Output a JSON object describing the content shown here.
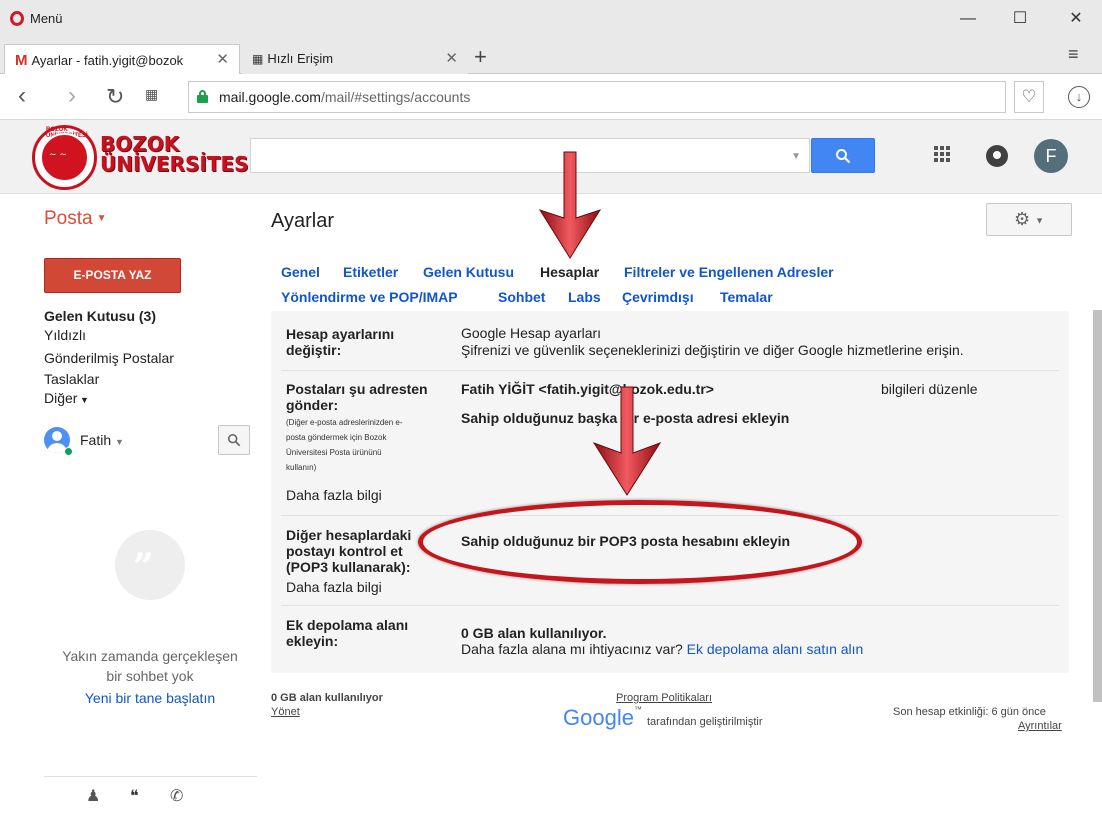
{
  "browser": {
    "menu_label": "Menü",
    "tabs": [
      {
        "label": "Ayarlar - fatih.yigit@bozok",
        "active": true
      },
      {
        "label": "Hızlı Erişim",
        "active": false
      }
    ],
    "url_host": "mail.google.com",
    "url_path": "/mail/#settings/accounts"
  },
  "brand": {
    "line1": "BOZOK",
    "line2": "ÜNİVERSİTESİ",
    "seal_ring": "BOZOK ÜNİVERSİTESİ",
    "seal_year": "2006",
    "user_initial": "F"
  },
  "header": {
    "posta_label": "Posta",
    "page_title": "Ayarlar"
  },
  "sidebar": {
    "compose_label": "E-POSTA YAZ",
    "items": [
      {
        "label": "Gelen Kutusu (3)",
        "bold": true
      },
      {
        "label": "Yıldızlı",
        "bold": false
      },
      {
        "label": "Gönderilmiş Postalar",
        "bold": false
      },
      {
        "label": "Taslaklar",
        "bold": false
      },
      {
        "label": "Diğer",
        "bold": false
      }
    ],
    "user_name": "Fatih",
    "chat_empty_line1": "Yakın zamanda gerçekleşen",
    "chat_empty_line2": "bir sohbet yok",
    "chat_start": "Yeni bir tane başlatın"
  },
  "settings_tabs": {
    "row1": [
      "Genel",
      "Etiketler",
      "Gelen Kutusu",
      "Hesaplar",
      "Filtreler ve Engellenen Adresler"
    ],
    "row2": [
      "Yönlendirme ve POP/IMAP",
      "Sohbet",
      "Labs",
      "Çevrimdışı",
      "Temalar"
    ],
    "current": "Hesaplar"
  },
  "sections": {
    "account": {
      "label_line1": "Hesap ayarlarını",
      "label_line2": "değiştir:",
      "link": "Google Hesap ayarları",
      "desc": "Şifrenizi ve güvenlik seçeneklerinizi değiştirin ve diğer Google hizmetlerine erişin."
    },
    "send_as": {
      "label_line1": "Postaları şu adresten",
      "label_line2": "gönder:",
      "note_lines": [
        "(Diğer e-posta adreslerinizden e-",
        "posta göndermek için Bozok",
        "Üniversitesi Posta ürününü",
        "kullanın)"
      ],
      "more_info": "Daha fazla bilgi",
      "address": "Fatih YİĞİT <fatih.yigit@bozok.edu.tr>",
      "edit_link": "bilgileri düzenle",
      "add_link": "Sahip olduğunuz başka bir e-posta adresi ekleyin"
    },
    "pop3": {
      "label_line1": "Diğer hesaplardaki",
      "label_line2": "postayı kontrol et",
      "label_line3": "(POP3 kullanarak):",
      "more_info": "Daha fazla bilgi",
      "add_link": "Sahip olduğunuz bir POP3 posta hesabını ekleyin"
    },
    "storage": {
      "label_line1": "Ek depolama alanı",
      "label_line2": "ekleyin:",
      "usage": "0 GB alan kullanılıyor.",
      "question": "Daha fazla alana mı ihtiyacınız var?",
      "buy_link": "Ek depolama alanı satın alın"
    }
  },
  "footer": {
    "usage": "0 GB alan kullanılıyor",
    "manage": "Yönet",
    "policies": "Program Politikaları",
    "google_word": "Google",
    "powered": "tarafından geliştirilmiştir",
    "activity": "Son hesap etkinliği: 6 gün önce",
    "details": "Ayrıntılar"
  },
  "colors": {
    "accent_red": "#dd4b39",
    "compose_bg": "#d14836",
    "link_blue": "#1155cc",
    "search_blue": "#4285f4",
    "annotation_red": "#c5161d"
  },
  "icons": [
    "opera-logo-icon",
    "gmail-icon",
    "grid-icon",
    "back-icon",
    "forward-icon",
    "reload-icon",
    "speed-dial-icon",
    "lock-icon",
    "heart-icon",
    "download-icon",
    "search-icon",
    "apps-icon",
    "notifications-icon",
    "gear-icon",
    "hangouts-icon",
    "person-icon",
    "phone-icon"
  ]
}
